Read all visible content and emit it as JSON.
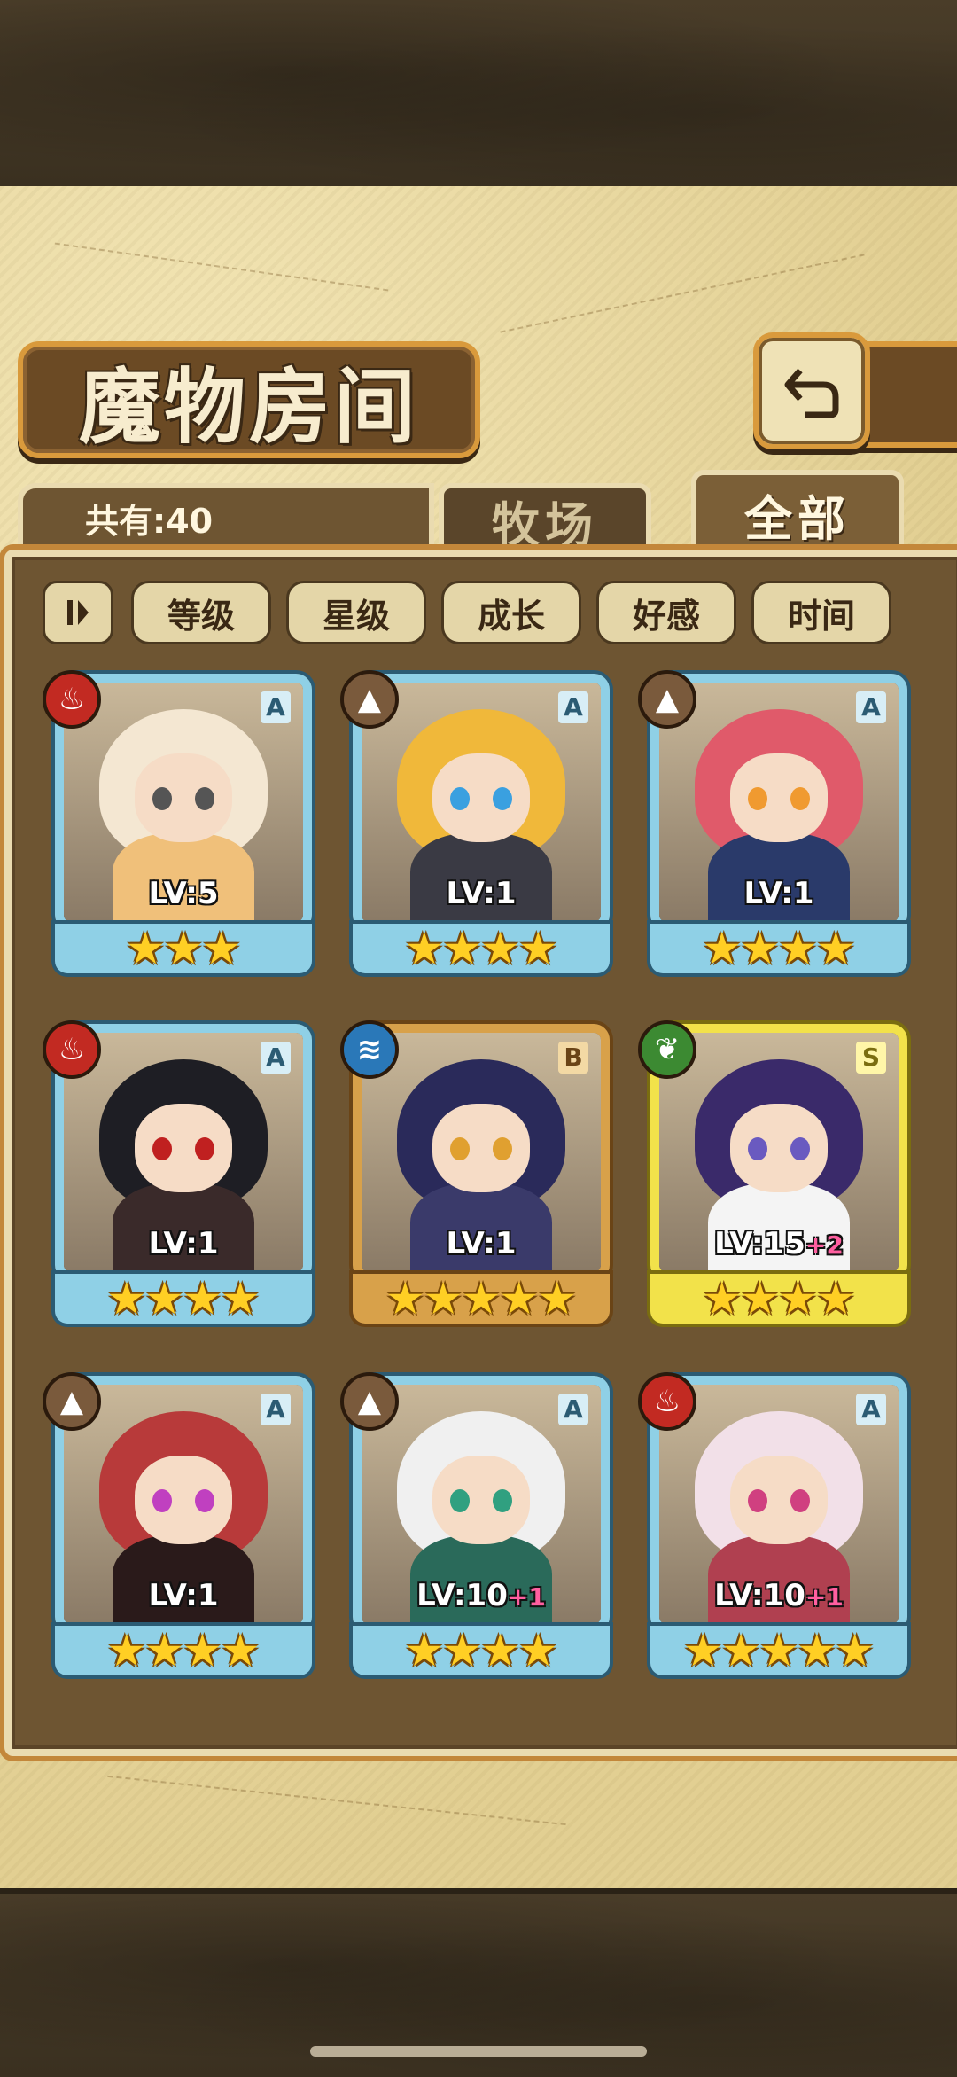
{
  "title": "魔物房间",
  "count_label": "共有:40",
  "tabs": {
    "ranch": "牧场",
    "all": "全部"
  },
  "sort": {
    "toggle_icon": "sort-toggle-icon",
    "buttons": [
      "等级",
      "星级",
      "成长",
      "好感",
      "时间"
    ]
  },
  "monsters": [
    {
      "element": "fire",
      "rank": "A",
      "level": "LV:5",
      "plus": "",
      "stars": 3,
      "frame": "blue",
      "palette": {
        "hair": "#f4e7d2",
        "body": "#f0c07a",
        "eye": "#555"
      }
    },
    {
      "element": "earth",
      "rank": "A",
      "level": "LV:1",
      "plus": "",
      "stars": 4,
      "frame": "blue",
      "palette": {
        "hair": "#f0b83a",
        "body": "#3a3a44",
        "eye": "#3aa0e0"
      }
    },
    {
      "element": "earth",
      "rank": "A",
      "level": "LV:1",
      "plus": "",
      "stars": 4,
      "frame": "blue",
      "palette": {
        "hair": "#e05a6a",
        "body": "#2a3a6a",
        "eye": "#f09a30"
      }
    },
    {
      "element": "fire",
      "rank": "A",
      "level": "LV:1",
      "plus": "",
      "stars": 4,
      "frame": "blue",
      "palette": {
        "hair": "#1e1e24",
        "body": "#3a2a2a",
        "eye": "#c02020"
      }
    },
    {
      "element": "water",
      "rank": "B",
      "level": "LV:1",
      "plus": "",
      "stars": 5,
      "frame": "gold",
      "palette": {
        "hair": "#2a2a5a",
        "body": "#3a3a6a",
        "eye": "#e0a030"
      }
    },
    {
      "element": "wind",
      "rank": "S",
      "level": "LV:15",
      "plus": "+2",
      "stars": 4,
      "frame": "yellow",
      "palette": {
        "hair": "#3a2a6a",
        "body": "#f4f4f4",
        "eye": "#6a5ac0"
      }
    },
    {
      "element": "earth",
      "rank": "A",
      "level": "LV:1",
      "plus": "",
      "stars": 4,
      "frame": "blue",
      "palette": {
        "hair": "#b83a3a",
        "body": "#2a1a1a",
        "eye": "#c040c0"
      }
    },
    {
      "element": "earth",
      "rank": "A",
      "level": "LV:10",
      "plus": "+1",
      "stars": 4,
      "frame": "blue",
      "palette": {
        "hair": "#f0f0f0",
        "body": "#2a6a5a",
        "eye": "#30a080"
      }
    },
    {
      "element": "fire",
      "rank": "A",
      "level": "LV:10",
      "plus": "+1",
      "stars": 5,
      "frame": "blue",
      "palette": {
        "hair": "#f2e0e8",
        "body": "#b04050",
        "eye": "#d04080"
      }
    }
  ],
  "element_icons": {
    "fire": "fire-icon",
    "earth": "mountain-icon",
    "water": "water-waves-icon",
    "wind": "leaf-icon"
  },
  "element_glyphs": {
    "fire": "♨",
    "earth": "▲",
    "water": "≋",
    "wind": "❦"
  }
}
